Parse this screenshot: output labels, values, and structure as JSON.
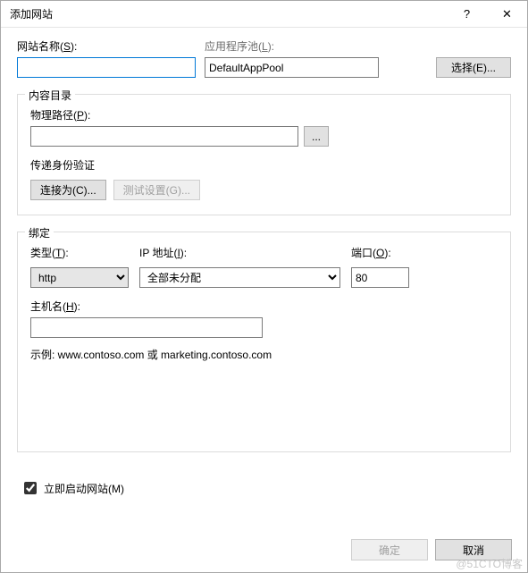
{
  "titlebar": {
    "title": "添加网站",
    "help": "?",
    "close": "✕"
  },
  "top": {
    "site_name_label_pre": "网站名称(",
    "site_name_label_u": "S",
    "site_name_label_post": "):",
    "site_name_value": "",
    "app_pool_label_pre": "应用程序池(",
    "app_pool_label_u": "L",
    "app_pool_label_post": "):",
    "app_pool_value": "DefaultAppPool",
    "select_btn_pre": "选择(",
    "select_btn_u": "E",
    "select_btn_post": ")..."
  },
  "content_dir": {
    "legend": "内容目录",
    "phys_label_pre": "物理路径(",
    "phys_label_u": "P",
    "phys_label_post": "):",
    "phys_value": "",
    "browse": "...",
    "auth_label": "传递身份验证",
    "connect_btn_pre": "连接为(",
    "connect_btn_u": "C",
    "connect_btn_post": ")...",
    "test_btn_pre": "测试设置(",
    "test_btn_u": "G",
    "test_btn_post": ")..."
  },
  "binding": {
    "legend": "绑定",
    "type_label_pre": "类型(",
    "type_label_u": "T",
    "type_label_post": "):",
    "type_value": "http",
    "ip_label_pre": "IP 地址(",
    "ip_label_u": "I",
    "ip_label_post": "):",
    "ip_value": "全部未分配",
    "port_label_pre": "端口(",
    "port_label_u": "O",
    "port_label_post": "):",
    "port_value": "80",
    "host_label_pre": "主机名(",
    "host_label_u": "H",
    "host_label_post": "):",
    "host_value": "",
    "example": "示例: www.contoso.com 或 marketing.contoso.com"
  },
  "start_now": {
    "label_pre": "立即启动网站(",
    "label_u": "M",
    "label_post": ")",
    "checked": true
  },
  "footer": {
    "ok": "确定",
    "cancel": "取消"
  },
  "watermark": "@51CTO博客"
}
